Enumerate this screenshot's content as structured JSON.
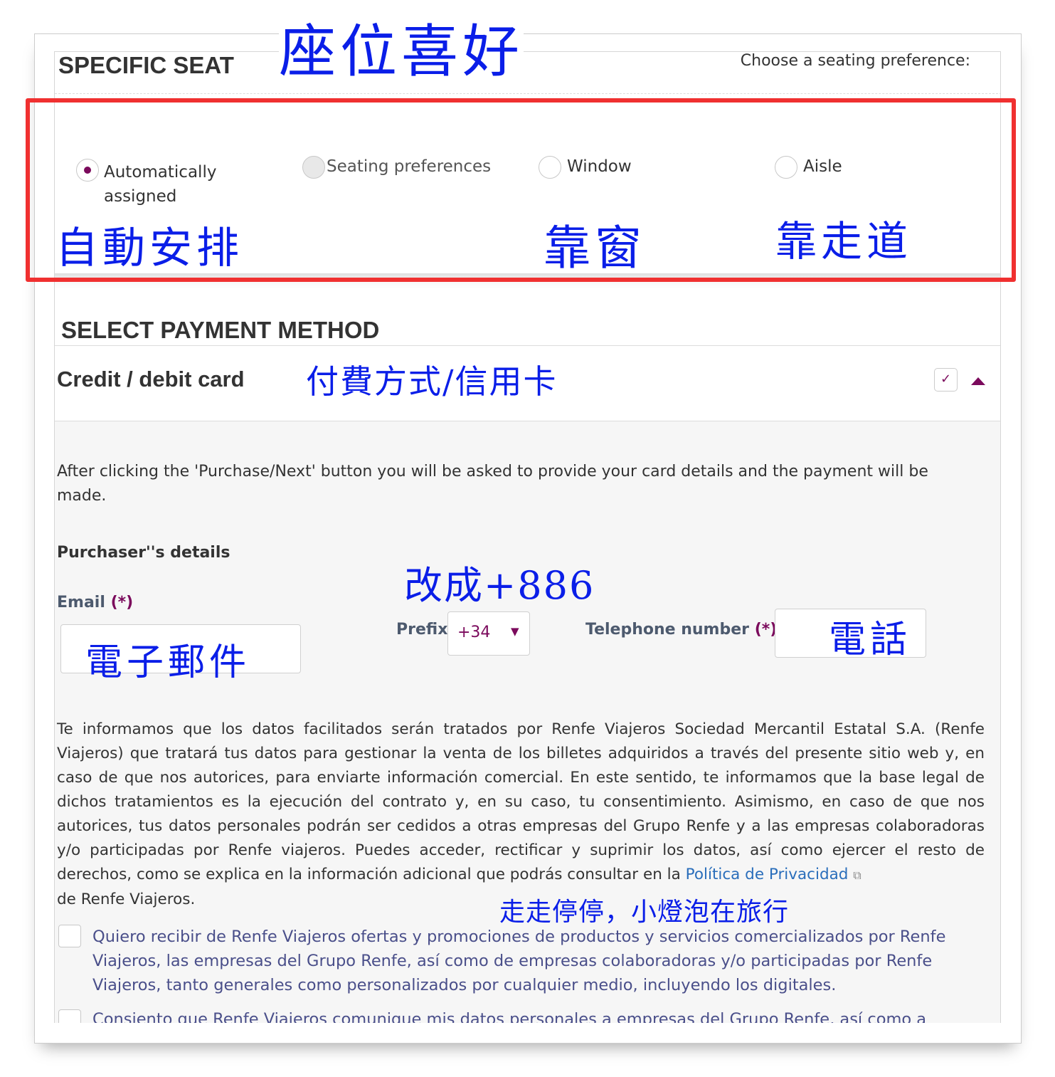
{
  "seat": {
    "title": "SPECIFIC SEAT",
    "prompt": "Choose a seating preference:",
    "options": [
      {
        "label": "Automatically assigned",
        "selected": true,
        "enabled": true
      },
      {
        "label": "Seating preferences",
        "selected": false,
        "enabled": false
      },
      {
        "label": "Window",
        "selected": false,
        "enabled": true
      },
      {
        "label": "Aisle",
        "selected": false,
        "enabled": true
      }
    ]
  },
  "payment": {
    "title": "SELECT PAYMENT METHOD",
    "method": "Credit / debit card",
    "info": "After clicking the 'Purchase/Next' button you will be asked to provide your card details and the payment will be made.",
    "purchaser_title": "Purchaser''s details",
    "email_label": "Email",
    "required_mark": "(*)",
    "email_value": "",
    "prefix_label": "Prefix",
    "prefix_value": "+34",
    "phone_label": "Telephone number",
    "phone_value": "",
    "privacy_text": "Te informamos que los datos facilitados serán tratados por Renfe Viajeros Sociedad Mercantil Estatal S.A. (Renfe Viajeros) que tratará tus datos para gestionar la venta de los billetes adquiridos a través del presente sitio web y, en caso de que nos autorices, para enviarte información comercial. En este sentido, te informamos que la base legal de dichos tratamientos es la ejecución del contrato y, en su caso, tu consentimiento. Asimismo, en caso de que nos autorices, tus datos personales podrán ser cedidos a otras empresas del Grupo Renfe y a las empresas colaboradoras y/o participadas por Renfe viajeros. Puedes acceder, rectificar y suprimir los datos, así como ejercer el resto de derechos, como se explica en la información adicional que podrás consultar en la",
    "privacy_link": "Política de Privacidad",
    "privacy_tail": "de Renfe Viajeros.",
    "consent1": "Quiero recibir de Renfe Viajeros ofertas y promociones de productos y servicios comercializados por Renfe Viajeros, las empresas del Grupo Renfe, así como de empresas colaboradoras y/o participadas por Renfe Viajeros, tanto generales como personalizados por cualquier medio, incluyendo los digitales.",
    "consent2": "Consiento que Renfe Viajeros comunique mis datos personales a empresas del Grupo Renfe, así como a"
  },
  "annotations": {
    "seat": "座位喜好",
    "auto": "自動安排",
    "window": "靠窗",
    "aisle": "靠走道",
    "card": "付費方式/信用卡",
    "prefix": "改成+886",
    "email": "電子郵件",
    "phone": "電話",
    "watermark": "走走停停，小燈泡在旅行"
  },
  "colors": {
    "accent": "#7b0a5c",
    "highlight": "#f03030",
    "annotation": "#0a1ee8",
    "link": "#2a6ebb"
  }
}
